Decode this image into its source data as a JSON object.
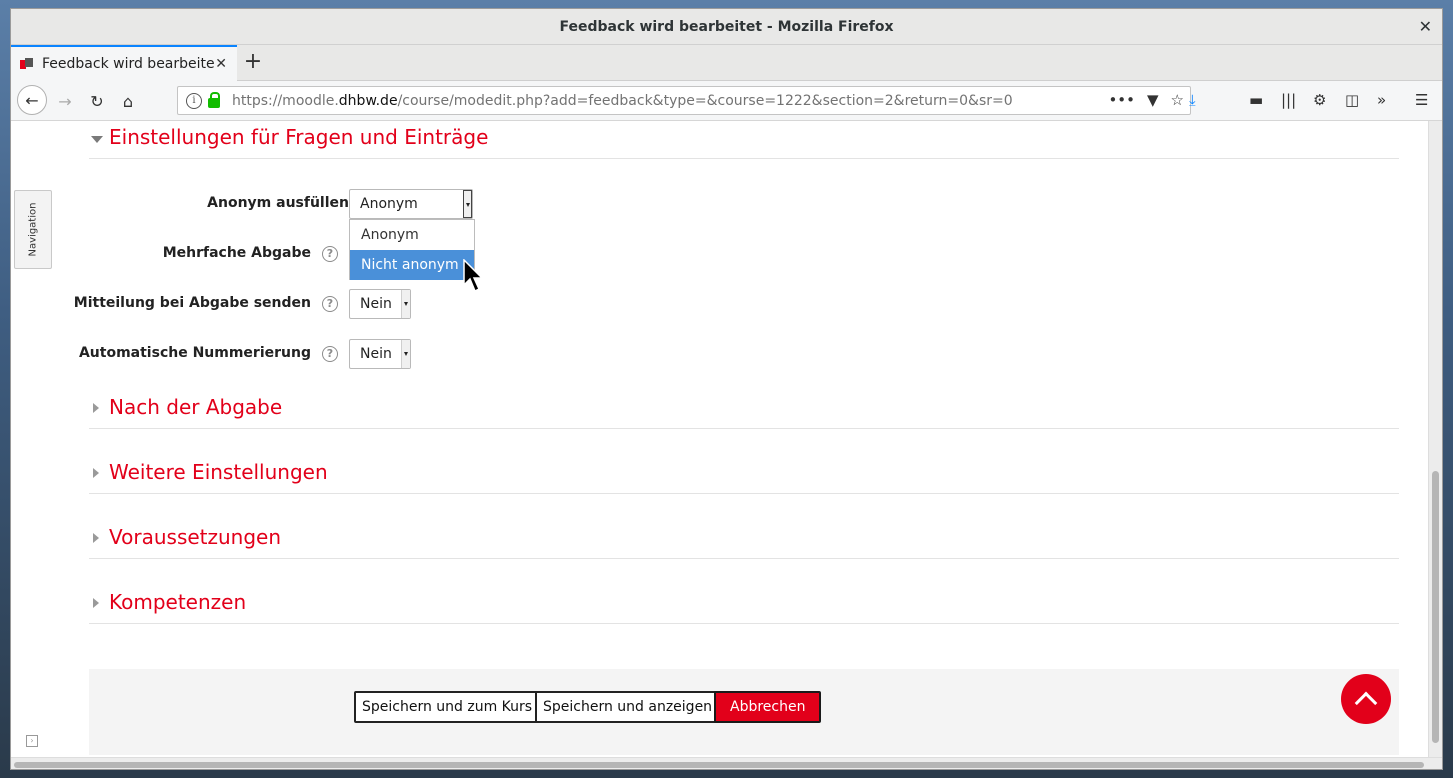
{
  "window": {
    "title": "Feedback wird bearbeitet - Mozilla Firefox"
  },
  "tab": {
    "label": "Feedback wird bearbeitet"
  },
  "urlbar": {
    "url_prefix": "https://moodle.",
    "url_domain": "dhbw.de",
    "url_path": "/course/modedit.php?add=feedback&type=&course=1222&section=2&return=0&sr=0"
  },
  "sidebar": {
    "navigation_label": "Navigation"
  },
  "sections": {
    "questions": "Einstellungen für Fragen und Einträge",
    "after_submit": "Nach der Abgabe",
    "more_settings": "Weitere Einstellungen",
    "restrictions": "Voraussetzungen",
    "competencies": "Kompetenzen"
  },
  "form": {
    "anonymous_label": "Anonym ausfüllen",
    "anonymous_value": "Anonym",
    "anonymous_options": [
      "Anonym",
      "Nicht anonym"
    ],
    "multiple_label": "Mehrfache Abgabe",
    "email_label": "Mitteilung bei Abgabe senden",
    "email_value": "Nein",
    "autonumber_label": "Automatische Nummerierung",
    "autonumber_value": "Nein"
  },
  "buttons": {
    "save_return": "Speichern und zum Kurs",
    "save_display": "Speichern und anzeigen",
    "cancel": "Abbrechen"
  },
  "colors": {
    "accent": "#e2001a",
    "selection": "#4a90d9"
  }
}
